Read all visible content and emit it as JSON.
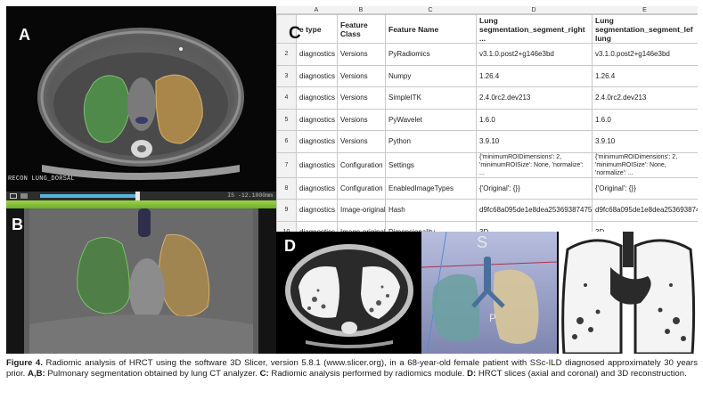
{
  "panels": {
    "a_label": "A",
    "b_label": "B",
    "c_label": "C",
    "d_label": "D",
    "recon_label": "RECON LUNG_DORSAL",
    "slider_value": "IS -12.1000mm",
    "recon_s_label": "S",
    "recon_p_label": "P"
  },
  "table": {
    "column_letters": [
      "A",
      "B",
      "C",
      "D",
      "E"
    ],
    "headers": [
      "e type",
      "Feature Class",
      "Feature Name",
      "Lung segmentation_segment_right ...",
      "Lung segmentation_segment_lef lung"
    ],
    "rows": [
      {
        "num": "2",
        "cells": [
          "diagnostics",
          "Versions",
          "PyRadiomics",
          "v3.1.0.post2+g146e3bd",
          "v3.1.0.post2+g146e3bd"
        ]
      },
      {
        "num": "3",
        "cells": [
          "diagnostics",
          "Versions",
          "Numpy",
          "1.26.4",
          "1.26.4"
        ]
      },
      {
        "num": "4",
        "cells": [
          "diagnostics",
          "Versions",
          "SimpleITK",
          "2.4.0rc2.dev213",
          "2.4.0rc2.dev213"
        ]
      },
      {
        "num": "5",
        "cells": [
          "diagnostics",
          "Versions",
          "PyWavelet",
          "1.6.0",
          "1.6.0"
        ]
      },
      {
        "num": "6",
        "cells": [
          "diagnostics",
          "Versions",
          "Python",
          "3.9.10",
          "3.9.10"
        ]
      },
      {
        "num": "7",
        "cells": [
          "diagnostics",
          "Configuration",
          "Settings",
          "{'minimumROIDimensions': 2, 'minimumROISize': None, 'normalize': ...",
          "{'minimumROIDimensions': 2, 'minimumROISize': None, 'normalize': ..."
        ]
      },
      {
        "num": "8",
        "cells": [
          "diagnostics",
          "Configuration",
          "EnabledImageTypes",
          "{'Original': {}}",
          "{'Original': {}}"
        ]
      },
      {
        "num": "9",
        "cells": [
          "diagnostics",
          "Image-original",
          "Hash",
          "d9fc68a095de1e8dea25369387475c4...",
          "d9fc68a095de1e8dea25369387475c4..."
        ]
      },
      {
        "num": "10",
        "cells": [
          "diagnostics",
          "Image-original",
          "Dimensionality",
          "3D",
          "3D"
        ]
      }
    ]
  },
  "caption": {
    "figure_label": "Figure 4.",
    "text_1": " Radiomic analysis of HRCT using the software 3D Slicer, version 5.8.1 (www.slicer.org), in a 68-year-old female patient with SSc-ILD diagnosed approximately 30 years prior. ",
    "ab_label": "A,B:",
    "text_2": " Pulmonary segmentation obtained by lung CT analyzer. ",
    "c_label": "C:",
    "text_3": " Radiomic analysis performed by radiomics module. ",
    "d_label": "D:",
    "text_4": " HRCT slices (axial and coronal) and 3D reconstruction."
  }
}
